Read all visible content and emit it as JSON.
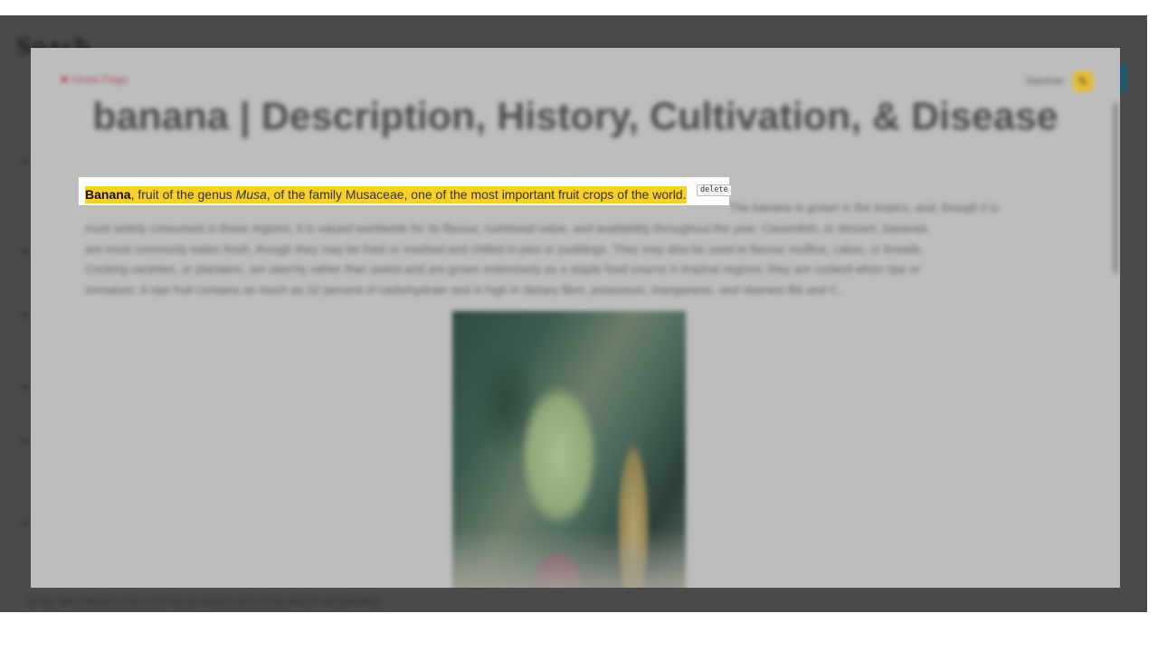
{
  "background_app": {
    "logo_text": "Sn•ch",
    "footer_text": "Sensor data collected. Click to see how we process and use this data for personalization."
  },
  "overlay": {
    "close_label": "✖ Close Page",
    "user_name": "Darshan",
    "page_title": "banana | Description, History, Cultivation, & Disease",
    "separator": "•••",
    "paragraph_lines": [
      "The banana is grown in the tropics, and, though it is",
      "most widely consumed in those regions, it is valued worldwide for its flavour, nutritional value, and availability throughout the year. Cavendish, or dessert, bananas",
      "are most commonly eaten fresh, though they may be fried or mashed and chilled in pies or puddings. They may also be used to flavour muffins, cakes, or breads.",
      "Cooking varieties, or plantains, are starchy rather than sweet and are grown extensively as a staple food source in tropical regions; they are cooked when ripe or",
      "immature. A ripe fruit contains as much as 22 percent of carbohydrate and is high in dietary fibre, potassium, manganese, and vitamins B6 and C."
    ],
    "highlight": {
      "bold": "Banana",
      "part1": ", fruit of the genus ",
      "italic": "Musa",
      "part2": ", of the family Musaceae, one of the most important fruit crops of the world.",
      "delete_label": "delete",
      "color": "#f9d028"
    },
    "image_icon": "banana-plant-photo",
    "user_icon": "pencil-icon"
  }
}
